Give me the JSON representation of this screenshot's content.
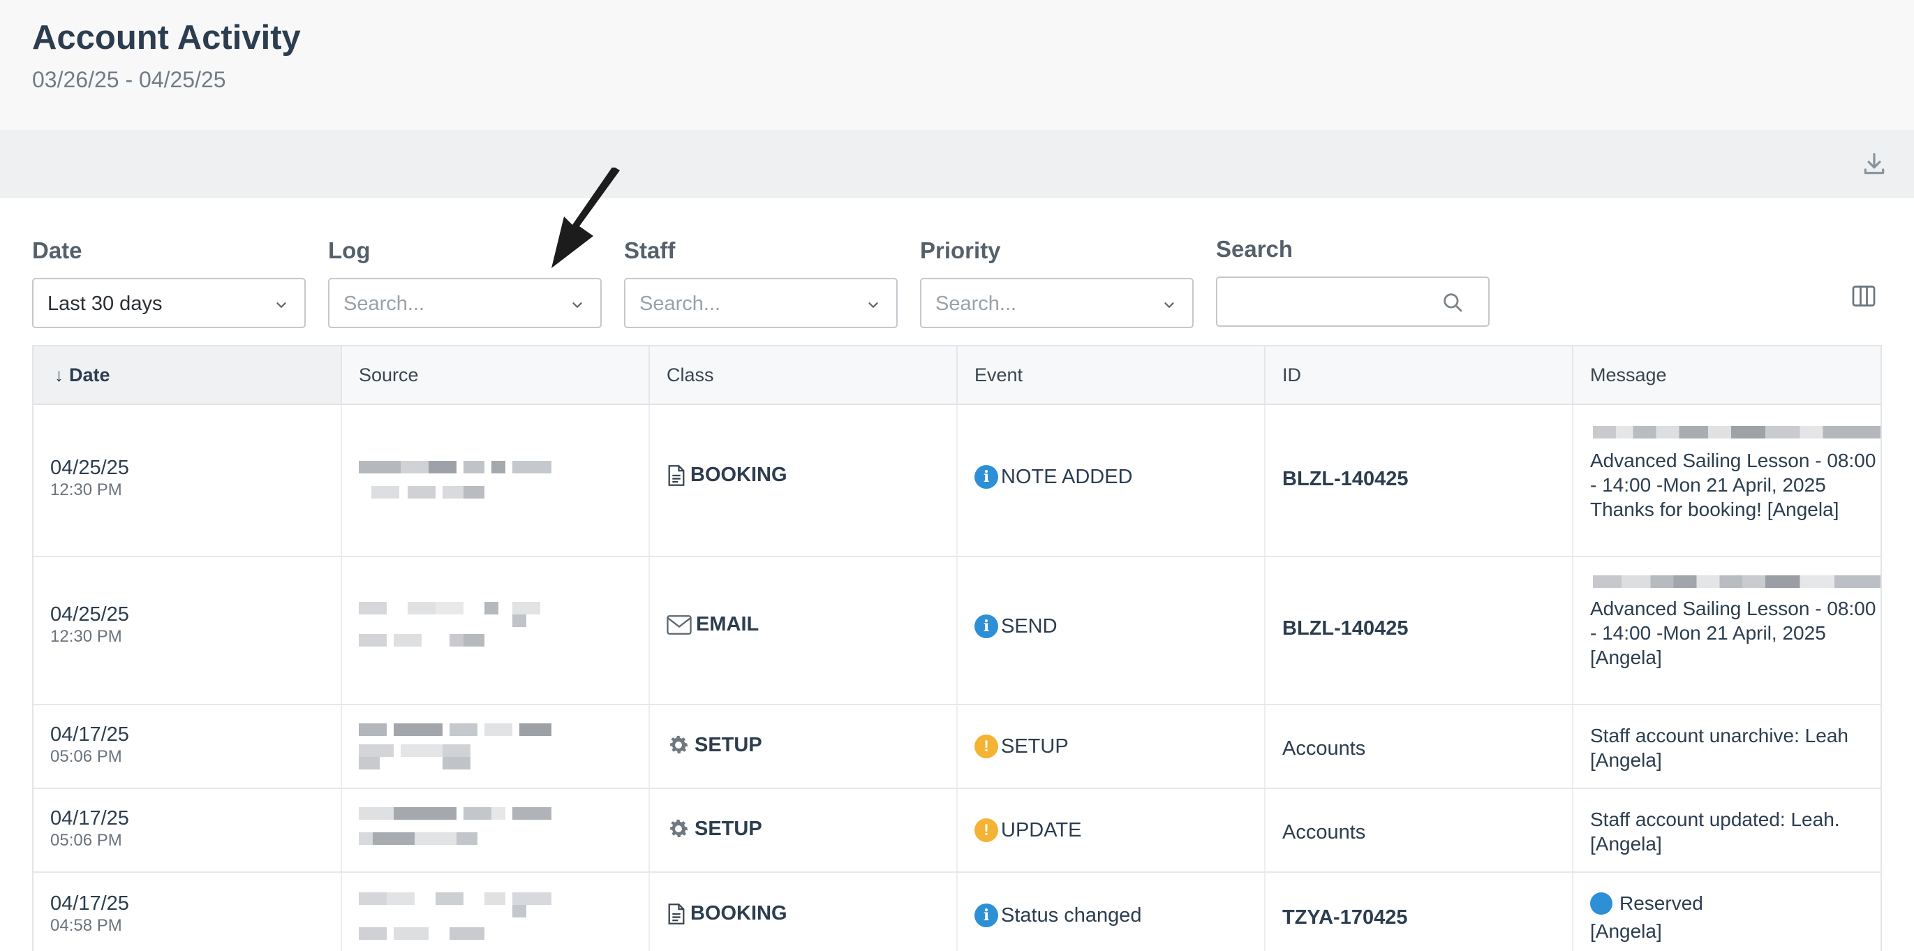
{
  "header": {
    "title": "Account Activity",
    "date_range": "03/26/25 - 04/25/25"
  },
  "filters": {
    "date": {
      "label": "Date",
      "value": "Last 30 days"
    },
    "log": {
      "label": "Log",
      "placeholder": "Search..."
    },
    "staff": {
      "label": "Staff",
      "placeholder": "Search..."
    },
    "priority": {
      "label": "Priority",
      "placeholder": "Search..."
    },
    "search": {
      "label": "Search",
      "value": ""
    }
  },
  "table": {
    "columns": [
      "Date",
      "Source",
      "Class",
      "Event",
      "ID",
      "Message"
    ],
    "sort_indicator": "↓",
    "rows": [
      {
        "date": "04/25/25",
        "time": "12:30 PM",
        "class": "BOOKING",
        "class_icon": "document-icon",
        "event": "NOTE ADDED",
        "event_type": "info",
        "id": "BLZL-140425",
        "id_bold": true,
        "message": "Advanced Sailing Lesson - 08:00 - 14:00 -Mon 21 April, 2025 Thanks for booking! [Angela]"
      },
      {
        "date": "04/25/25",
        "time": "12:30 PM",
        "class": "EMAIL",
        "class_icon": "envelope-icon",
        "event": "SEND",
        "event_type": "info",
        "id": "BLZL-140425",
        "id_bold": true,
        "message": "Advanced Sailing Lesson - 08:00 - 14:00 -Mon 21 April, 2025 [Angela]"
      },
      {
        "date": "04/17/25",
        "time": "05:06 PM",
        "class": "SETUP",
        "class_icon": "gear-icon",
        "event": "SETUP",
        "event_type": "warning",
        "id": "Accounts",
        "id_bold": false,
        "message": "Staff account unarchive: Leah [Angela]"
      },
      {
        "date": "04/17/25",
        "time": "05:06 PM",
        "class": "SETUP",
        "class_icon": "gear-icon",
        "event": "UPDATE",
        "event_type": "warning",
        "id": "Accounts",
        "id_bold": false,
        "message": "Staff account updated: Leah. [Angela]"
      },
      {
        "date": "04/17/25",
        "time": "04:58 PM",
        "class": "BOOKING",
        "class_icon": "document-icon",
        "event": "Status changed",
        "event_type": "info",
        "id": "TZYA-170425",
        "id_bold": true,
        "message_status": "Reserved",
        "message": "[Angela]"
      }
    ]
  },
  "colors": {
    "info": "#2d8fd6",
    "warning": "#f5b335",
    "header_bg": "#f8f8f9",
    "toolbar_bg": "#eef0f2"
  }
}
